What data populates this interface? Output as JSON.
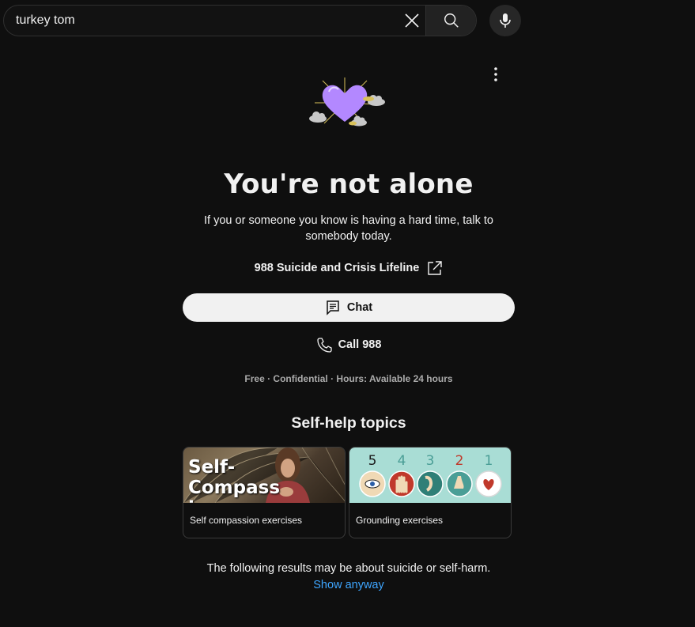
{
  "search": {
    "value": "turkey tom"
  },
  "crisis": {
    "title": "You're not alone",
    "description": "If you or someone you know is having a hard time, talk to somebody today.",
    "lifeline_label": "988 Suicide and Crisis Lifeline",
    "chat_label": "Chat",
    "call_label": "Call 988",
    "meta": "Free · Confidential · Hours: Available 24 hours"
  },
  "selfhelp": {
    "title": "Self-help topics",
    "cards": [
      {
        "thumb_text": "Self-Compassion",
        "label": "Self compassion exercises"
      },
      {
        "thumb_numbers": [
          "5",
          "4",
          "3",
          "2",
          "1"
        ],
        "label": "Grounding exercises"
      }
    ]
  },
  "footer": {
    "warning": "The following results may be about suicide or self-harm.",
    "show_anyway": "Show anyway"
  },
  "colors": {
    "background": "#0f0f0f",
    "link": "#3ea6ff",
    "button": "#f1f1f1",
    "heart": "#b388ff"
  },
  "icons": [
    "clear-icon",
    "search-icon",
    "mic-icon",
    "more-vert-icon",
    "external-link-icon",
    "chat-icon",
    "phone-icon",
    "heart-illustration"
  ]
}
